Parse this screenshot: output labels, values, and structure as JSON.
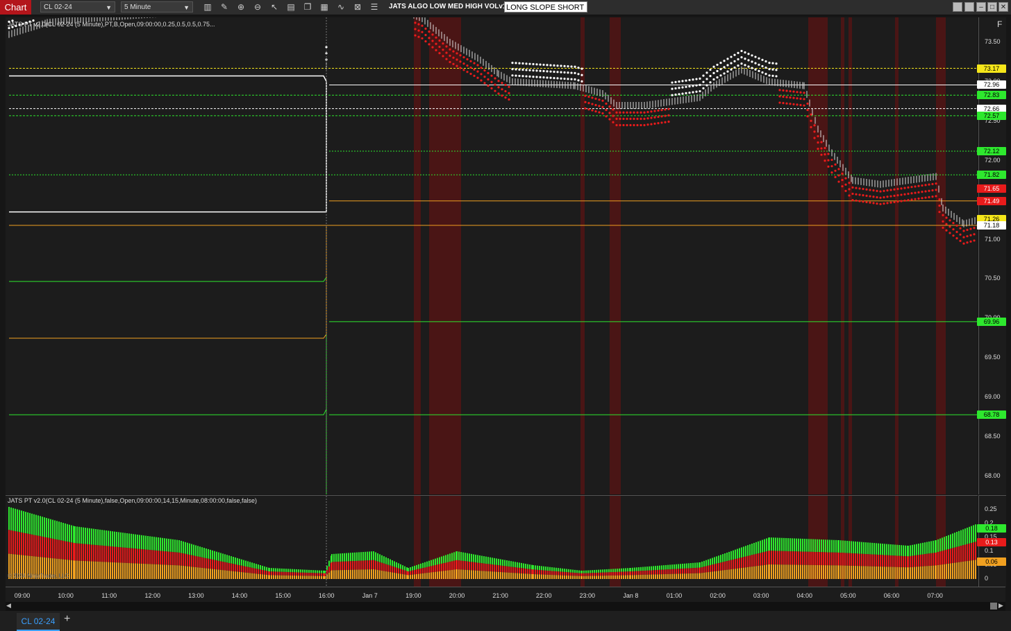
{
  "toolbar": {
    "chart_label": "Chart",
    "instrument": "CL 02-24",
    "interval": "5 Minute",
    "strategy_label": "JATS ALGO LOW MED HIGH VOLv1",
    "mode_value": "LONG SLOPE SHORT"
  },
  "price_panel": {
    "indicator_label": "JATS PT v2.0(CL 02-24 (5 Minute),PT,B,Open,09:00:00,0.25,0.5,0.5,0.75...",
    "f_button": "F",
    "y_ticks": [
      "73.50",
      "73.00",
      "72.50",
      "72.00",
      "71.50",
      "71.00",
      "70.50",
      "70.00",
      "69.50",
      "69.00",
      "68.50",
      "68.00"
    ],
    "price_labels": [
      {
        "text": "73.17",
        "color": "#f5e61a"
      },
      {
        "text": "72.96",
        "color": "#ffffff"
      },
      {
        "text": "72.83",
        "color": "#2ee82e"
      },
      {
        "text": "72.66",
        "color": "#ffffff"
      },
      {
        "text": "72.57",
        "color": "#2ee82e"
      },
      {
        "text": "72.12",
        "color": "#2ee82e"
      },
      {
        "text": "71.82",
        "color": "#2ee82e"
      },
      {
        "text": "71.65",
        "color": "#e81b1b"
      },
      {
        "text": "71.49",
        "color": "#e81b1b"
      },
      {
        "text": "71.26",
        "color": "#f5e61a"
      },
      {
        "text": "71.18",
        "color": "#ffffff"
      },
      {
        "text": "69.96",
        "color": "#2ee82e"
      },
      {
        "text": "68.78",
        "color": "#2ee82e"
      }
    ]
  },
  "osc_panel": {
    "indicator_label": "JATS PT v2.0(CL 02-24 (5 Minute),false,Open,09:00:00,14,15,Minute,08:00:00,false,false)",
    "y_ticks": [
      "0.25",
      "0.2",
      "0.15",
      "0.1",
      "0.05",
      "0"
    ],
    "price_labels": [
      {
        "text": "0.18",
        "color": "#2ee82e"
      },
      {
        "text": "0.13",
        "color": "#e81b1b"
      },
      {
        "text": "0.06",
        "color": "#f0a020"
      }
    ],
    "copyright": "© 2024 NinjaTrader, LLC"
  },
  "x_axis": {
    "labels": [
      "09:00",
      "10:00",
      "11:00",
      "12:00",
      "13:00",
      "14:00",
      "15:00",
      "16:00",
      "Jan 7",
      "19:00",
      "20:00",
      "21:00",
      "22:00",
      "23:00",
      "Jan 8",
      "01:00",
      "02:00",
      "03:00",
      "04:00",
      "05:00",
      "06:00",
      "07:00"
    ]
  },
  "tabs": {
    "active": "CL 02-24",
    "add": "+"
  },
  "colors": {
    "red": "#e81b1b",
    "green": "#2ee82e",
    "yellow": "#f5e61a",
    "orange": "#f0a020",
    "white": "#ffffff",
    "accent": "#b3151b"
  }
}
